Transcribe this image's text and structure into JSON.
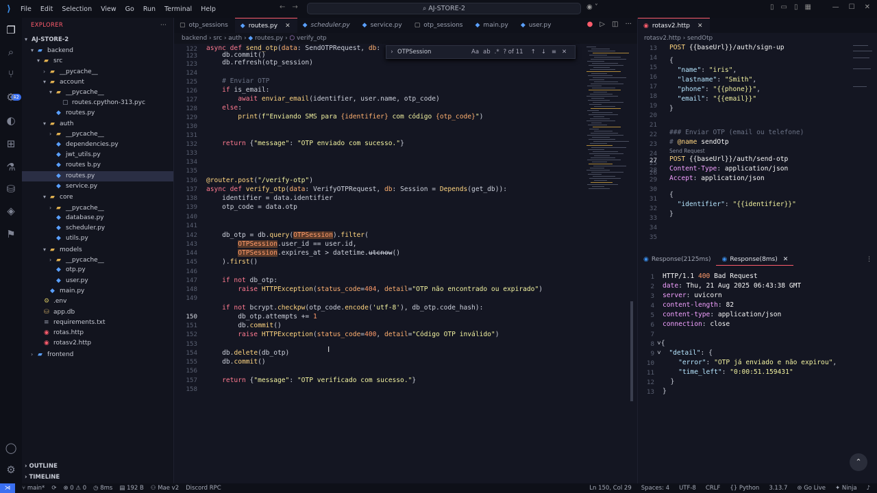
{
  "titlebar": {
    "menu": [
      "File",
      "Edit",
      "Selection",
      "View",
      "Go",
      "Run",
      "Terminal",
      "Help"
    ],
    "command_center": "AJ-STORE-2"
  },
  "explorer": {
    "title": "EXPLORER",
    "root": "AJ-STORE-2",
    "items": [
      {
        "label": "backend",
        "depth": 1,
        "type": "folder",
        "open": true
      },
      {
        "label": "src",
        "depth": 2,
        "type": "folder",
        "open": true
      },
      {
        "label": "__pycache__",
        "depth": 3,
        "type": "folder",
        "open": false
      },
      {
        "label": "account",
        "depth": 3,
        "type": "folder",
        "open": true
      },
      {
        "label": "__pycache__",
        "depth": 4,
        "type": "folder",
        "open": true
      },
      {
        "label": "routes.cpython-313.pyc",
        "depth": 5,
        "type": "file"
      },
      {
        "label": "routes.py",
        "depth": 4,
        "type": "py"
      },
      {
        "label": "auth",
        "depth": 3,
        "type": "folder",
        "open": true
      },
      {
        "label": "__pycache__",
        "depth": 4,
        "type": "folder",
        "open": false
      },
      {
        "label": "dependencies.py",
        "depth": 4,
        "type": "py"
      },
      {
        "label": "jwt_utils.py",
        "depth": 4,
        "type": "py"
      },
      {
        "label": "routes b.py",
        "depth": 4,
        "type": "py"
      },
      {
        "label": "routes.py",
        "depth": 4,
        "type": "py",
        "selected": true
      },
      {
        "label": "service.py",
        "depth": 4,
        "type": "py"
      },
      {
        "label": "core",
        "depth": 3,
        "type": "folder",
        "open": true
      },
      {
        "label": "__pycache__",
        "depth": 4,
        "type": "folder",
        "open": false
      },
      {
        "label": "database.py",
        "depth": 4,
        "type": "py"
      },
      {
        "label": "scheduler.py",
        "depth": 4,
        "type": "py"
      },
      {
        "label": "utils.py",
        "depth": 4,
        "type": "py"
      },
      {
        "label": "models",
        "depth": 3,
        "type": "folder",
        "open": true
      },
      {
        "label": "__pycache__",
        "depth": 4,
        "type": "folder",
        "open": false
      },
      {
        "label": "otp.py",
        "depth": 4,
        "type": "py"
      },
      {
        "label": "user.py",
        "depth": 4,
        "type": "py"
      },
      {
        "label": "main.py",
        "depth": 3,
        "type": "py"
      },
      {
        "label": ".env",
        "depth": 2,
        "type": "env"
      },
      {
        "label": "app.db",
        "depth": 2,
        "type": "db"
      },
      {
        "label": "requirements.txt",
        "depth": 2,
        "type": "txt"
      },
      {
        "label": "rotas.http",
        "depth": 2,
        "type": "http"
      },
      {
        "label": "rotasv2.http",
        "depth": 2,
        "type": "http"
      },
      {
        "label": "frontend",
        "depth": 1,
        "type": "folder",
        "open": false
      }
    ],
    "outline": "OUTLINE",
    "timeline": "TIMELINE"
  },
  "editor": {
    "tabs": [
      {
        "label": "otp_sessions",
        "icon": "file-icon"
      },
      {
        "label": "routes.py",
        "icon": "python-icon",
        "active": true
      },
      {
        "label": "scheduler.py",
        "icon": "python-icon",
        "italic": true
      },
      {
        "label": "service.py",
        "icon": "python-icon"
      },
      {
        "label": "otp_sessions",
        "icon": "file-icon"
      },
      {
        "label": "main.py",
        "icon": "python-icon"
      },
      {
        "label": "user.py",
        "icon": "python-icon"
      }
    ],
    "breadcrumb": [
      "backend",
      "src",
      "auth",
      "routes.py",
      "verify_otp"
    ],
    "find": {
      "query": "OTPSession",
      "count": "? of 11"
    }
  },
  "right": {
    "tab": "rotasv2.http",
    "breadcrumb": [
      "rotasv2.http",
      "sendOtp"
    ],
    "codelens": "Send Request",
    "response_tabs": [
      "Response(2125ms)",
      "Response(8ms)"
    ]
  },
  "statusbar": {
    "branch": "main*",
    "problems": "0 ⚠ 0",
    "timer": "8ms",
    "size": "192 B",
    "profile": "Mae v2",
    "discord": "Discord RPC",
    "position": "Ln 150, Col 29",
    "spaces": "Spaces: 4",
    "encoding": "UTF-8",
    "eol": "CRLF",
    "language": "Python",
    "version": "3.13.7",
    "golive": "Go Live",
    "ninja": "Ninja"
  }
}
